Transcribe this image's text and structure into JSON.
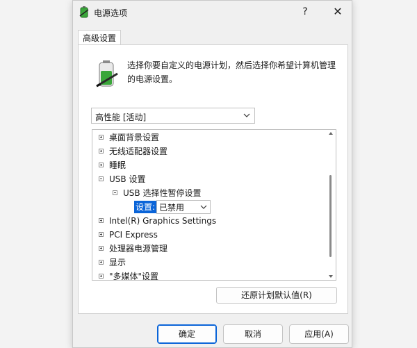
{
  "window": {
    "title": "电源选项",
    "help": "?",
    "close": "✕"
  },
  "tabs": [
    {
      "label": "高级设置"
    }
  ],
  "description": "选择你要自定义的电源计划，然后选择你希望计算机管理的电源设置。",
  "plan_select": {
    "value": "高性能 [活动]"
  },
  "tree": {
    "items": [
      {
        "label": "桌面背景设置",
        "expanded": false
      },
      {
        "label": "无线适配器设置",
        "expanded": false
      },
      {
        "label": "睡眠",
        "expanded": false
      },
      {
        "label": "USB 设置",
        "expanded": true
      },
      {
        "label": "USB 选择性暂停设置",
        "expanded": true
      },
      {
        "label": "Intel(R) Graphics Settings",
        "expanded": false
      },
      {
        "label": "PCI Express",
        "expanded": false
      },
      {
        "label": "处理器电源管理",
        "expanded": false
      },
      {
        "label": "显示",
        "expanded": false
      },
      {
        "label": "\"多媒体\"设置",
        "expanded": false
      }
    ],
    "setting": {
      "label": "设置:",
      "value": "已禁用"
    }
  },
  "restore_button": "还原计划默认值(R)",
  "buttons": {
    "ok": "确定",
    "cancel": "取消",
    "apply": "应用(A)"
  },
  "colors": {
    "selection": "#0a64d8",
    "battery_green": "#3aa63a"
  }
}
